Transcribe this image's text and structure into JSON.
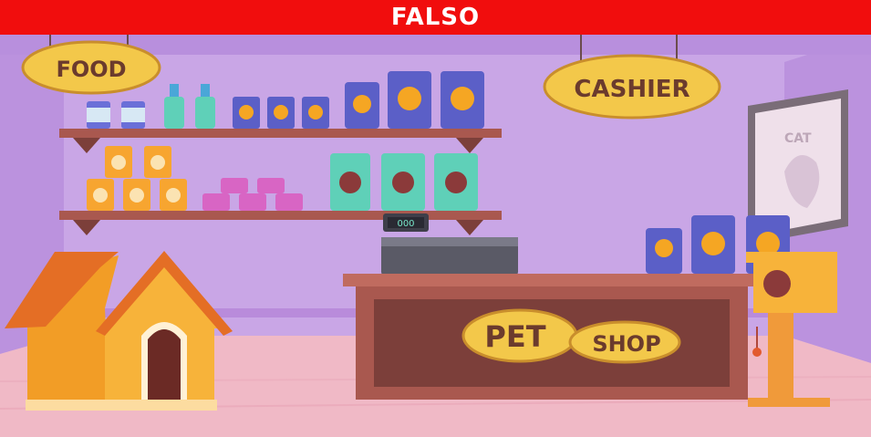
{
  "banner": {
    "label": "FALSO",
    "color": "#f10d0d"
  },
  "signs": {
    "food": "FOOD",
    "cashier": "CASHIER"
  },
  "counter": {
    "word1": "PET",
    "word2": "SHOP"
  },
  "poster": {
    "text": "CAT"
  },
  "register": {
    "display": "000"
  },
  "colors": {
    "wall": "#c9a6e6",
    "floor": "#f0b9c6",
    "shelf": "#a9584f",
    "counter": "#a9584f",
    "sign": "#f3c84a",
    "doghouse": "#f7b33a"
  }
}
